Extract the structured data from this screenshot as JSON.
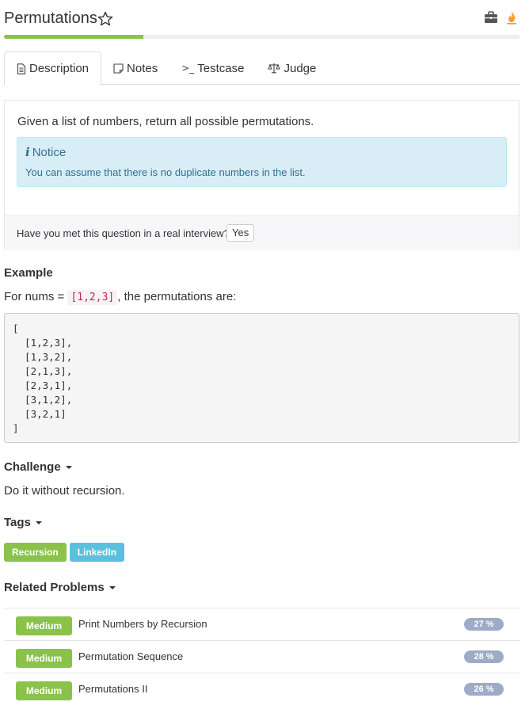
{
  "header": {
    "title": "Permutations",
    "progress_percent": 27
  },
  "tabs": [
    {
      "label": "Description",
      "icon": "document-icon",
      "active": true
    },
    {
      "label": "Notes",
      "icon": "note-icon",
      "active": false
    },
    {
      "label": "Testcase",
      "icon": "terminal-icon",
      "active": false
    },
    {
      "label": "Judge",
      "icon": "scales-icon",
      "active": false
    }
  ],
  "description": {
    "text": "Given a list of numbers, return all possible permutations.",
    "notice_title": "Notice",
    "notice_text": "You can assume that there is no duplicate numbers in the list.",
    "interview_question": "Have you met this question in a real interview?",
    "yes_label": "Yes"
  },
  "example": {
    "heading": "Example",
    "prefix": "For nums =",
    "code": "[1,2,3]",
    "suffix": ", the permutations are:",
    "lines": [
      "[",
      "  [1,2,3],",
      "  [1,3,2],",
      "  [2,1,3],",
      "  [2,3,1],",
      "  [3,1,2],",
      "  [3,2,1]",
      "]"
    ]
  },
  "challenge": {
    "heading": "Challenge",
    "text": "Do it without recursion."
  },
  "tags": {
    "heading": "Tags",
    "items": [
      {
        "label": "Recursion",
        "color": "#8bc34a"
      },
      {
        "label": "LinkedIn",
        "color": "#5bc0de"
      }
    ]
  },
  "related": {
    "heading": "Related Problems",
    "items": [
      {
        "difficulty": "Medium",
        "title": "Print Numbers by Recursion",
        "percent": "27 %"
      },
      {
        "difficulty": "Medium",
        "title": "Permutation Sequence",
        "percent": "28 %"
      },
      {
        "difficulty": "Medium",
        "title": "Permutations II",
        "percent": "26 %"
      }
    ]
  },
  "colors": {
    "accent_green": "#8bc34a",
    "info_blue": "#31708f",
    "fire_orange": "#f0a030"
  }
}
